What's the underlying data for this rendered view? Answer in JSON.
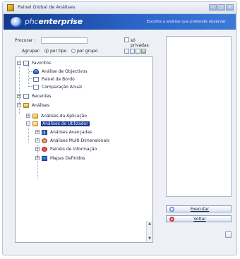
{
  "window": {
    "title": "Painel Global de Análises"
  },
  "banner": {
    "logo_prefix": "phc",
    "logo_main": "enterprise",
    "hint": "Escolha a análise que pretende observar"
  },
  "filters": {
    "search_label": "Procurar :",
    "search_value": "",
    "private_label": "só privadas",
    "group_label": "Agrupar:",
    "by_type_label": "por tipo",
    "by_group_label": "por grupo",
    "selected_grouping": "por tipo"
  },
  "tree": {
    "favorites": {
      "label": "Favoritos",
      "children": [
        "Análise de Objectivos",
        "Painel de Bordo",
        "Comparação Anual"
      ]
    },
    "recent": {
      "label": "Recentes"
    },
    "analyses": {
      "label": "Análises",
      "app_label": "Análises da Aplicação",
      "user_label": "Análises do Utilizador",
      "user_children": [
        "Análises Avançadas",
        "Análises Multi-Dimensionais",
        "Painéis de Informação",
        "Mapas Definidos"
      ]
    },
    "selected": "Análises do Utilizador"
  },
  "actions": {
    "execute_label": "Executar",
    "exit_label": "Voltar"
  },
  "colors": {
    "banner": "#123a8a",
    "selection": "#16368e"
  }
}
